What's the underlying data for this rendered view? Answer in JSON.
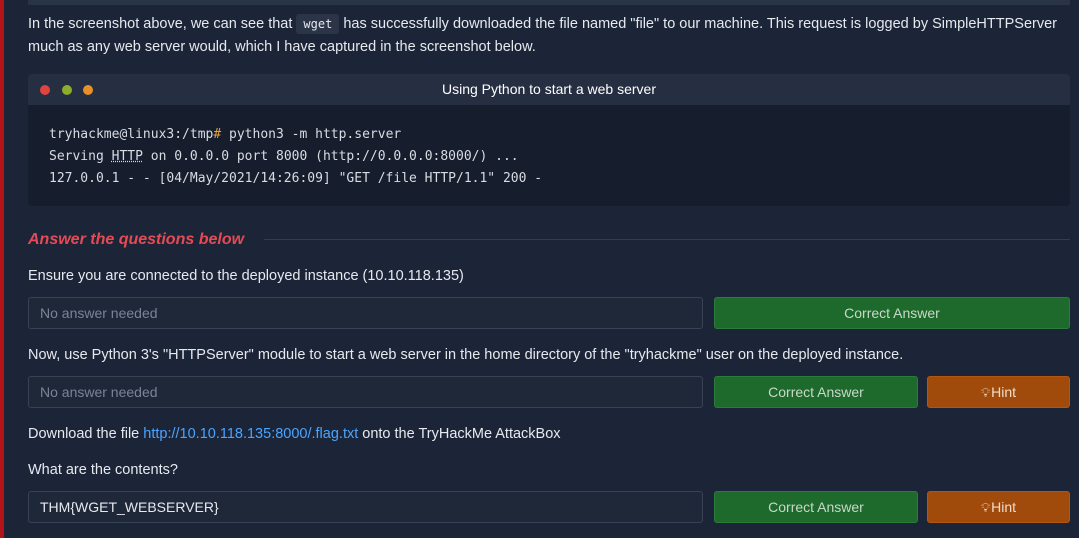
{
  "intro": {
    "before": "In the screenshot above, we can see that ",
    "code": "wget",
    "after": " has successfully downloaded the file named \"file\" to our machine. This request is logged by SimpleHTTPServer much as any web server would, which I have captured in the screenshot below."
  },
  "terminal": {
    "title": "Using Python to start a web server",
    "prompt": "tryhackme@linux3:/tmp",
    "hash": "#",
    "command": " python3 -m http.server",
    "line2_before": "Serving ",
    "line2_http": "HTTP",
    "line2_after": " on 0.0.0.0 port 8000 (http://0.0.0.0:8000/) ...",
    "line3": "127.0.0.1 - - [04/May/2021/14:26:09] \"GET /file HTTP/1.1\" 200 -"
  },
  "section_title": "Answer the questions below",
  "questions": [
    {
      "text": "Ensure you are connected to the deployed instance (10.10.118.135)",
      "answer_placeholder": "No answer needed",
      "correct_label": "Correct Answer"
    },
    {
      "text": "Now, use Python 3's \"HTTPServer\" module to start a web server in the home directory of the \"tryhackme\" user on the deployed instance.",
      "answer_placeholder": "No answer needed",
      "correct_label": "Correct Answer",
      "hint_label": "Hint"
    },
    {
      "text_before": "Download the file ",
      "link": "http://10.10.118.135:8000/.flag.txt",
      "text_after": " onto the TryHackMe AttackBox",
      "sub_text": "What are the contents?",
      "answer_value": "THM{WGET_WEBSERVER}",
      "correct_label": "Correct Answer",
      "hint_label": "Hint"
    }
  ],
  "icons": {
    "hint": "lightbulb-icon"
  },
  "colors": {
    "accent_red": "#e64a54",
    "correct_green": "#1e6a2c",
    "hint_orange": "#a04b0c",
    "link_blue": "#4aa4ff"
  }
}
